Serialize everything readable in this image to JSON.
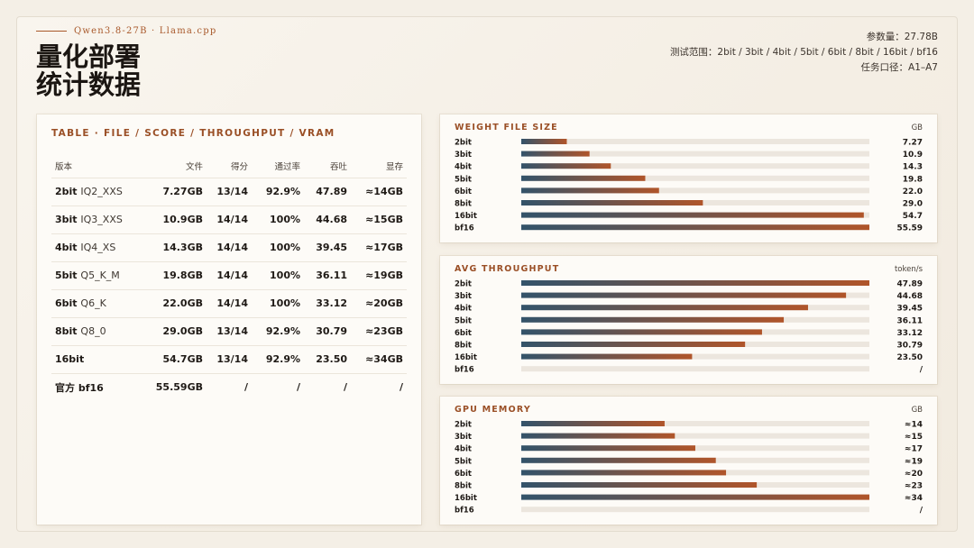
{
  "header": {
    "kicker": "Qwen3.8-27B  ·  Llama.cpp",
    "title_line1": "量化部署",
    "title_line2": "统计数据",
    "meta_params": "参数量：27.78B",
    "meta_range": "测试范围：2bit / 3bit / 4bit / 5bit / 6bit / 8bit / 16bit / bf16",
    "meta_tasks": "任务口径：A1–A7"
  },
  "table": {
    "title": "TABLE · FILE / SCORE / THROUGHPUT / VRAM",
    "headers": [
      "版本",
      "文件",
      "得分",
      "通过率",
      "吞吐",
      "显存"
    ],
    "rows": [
      {
        "bits": "2bit",
        "quant": "IQ2_XXS",
        "file": "7.27GB",
        "score": "13/14",
        "pass": "92.9%",
        "tput": "47.89",
        "vram": "≈14GB"
      },
      {
        "bits": "3bit",
        "quant": "IQ3_XXS",
        "file": "10.9GB",
        "score": "14/14",
        "pass": "100%",
        "tput": "44.68",
        "vram": "≈15GB"
      },
      {
        "bits": "4bit",
        "quant": "IQ4_XS",
        "file": "14.3GB",
        "score": "14/14",
        "pass": "100%",
        "tput": "39.45",
        "vram": "≈17GB"
      },
      {
        "bits": "5bit",
        "quant": "Q5_K_M",
        "file": "19.8GB",
        "score": "14/14",
        "pass": "100%",
        "tput": "36.11",
        "vram": "≈19GB"
      },
      {
        "bits": "6bit",
        "quant": "Q6_K",
        "file": "22.0GB",
        "score": "14/14",
        "pass": "100%",
        "tput": "33.12",
        "vram": "≈20GB"
      },
      {
        "bits": "8bit",
        "quant": "Q8_0",
        "file": "29.0GB",
        "score": "13/14",
        "pass": "92.9%",
        "tput": "30.79",
        "vram": "≈23GB"
      },
      {
        "bits": "16bit",
        "quant": "",
        "file": "54.7GB",
        "score": "13/14",
        "pass": "92.9%",
        "tput": "23.50",
        "vram": "≈34GB"
      },
      {
        "bits": "官方 bf16",
        "quant": "",
        "file": "55.59GB",
        "score": "/",
        "pass": "/",
        "tput": "/",
        "vram": "/"
      }
    ]
  },
  "colors": {
    "bar_start": "#33536a",
    "bar_end": "#b0552a",
    "track": "#ece6de",
    "accent": "#9a4f26"
  },
  "chart_data": [
    {
      "type": "bar",
      "title": "WEIGHT FILE SIZE",
      "unit": "GB",
      "categories": [
        "2bit",
        "3bit",
        "4bit",
        "5bit",
        "6bit",
        "8bit",
        "16bit",
        "bf16"
      ],
      "values": [
        7.27,
        10.9,
        14.3,
        19.8,
        22.0,
        29.0,
        54.7,
        55.59
      ],
      "labels": [
        "7.27",
        "10.9",
        "14.3",
        "19.8",
        "22.0",
        "29.0",
        "54.7",
        "55.59"
      ],
      "max": 55.59
    },
    {
      "type": "bar",
      "title": "AVG THROUGHPUT",
      "unit": "token/s",
      "categories": [
        "2bit",
        "3bit",
        "4bit",
        "5bit",
        "6bit",
        "8bit",
        "16bit",
        "bf16"
      ],
      "values": [
        47.89,
        44.68,
        39.45,
        36.11,
        33.12,
        30.79,
        23.5,
        null
      ],
      "labels": [
        "47.89",
        "44.68",
        "39.45",
        "36.11",
        "33.12",
        "30.79",
        "23.50",
        "/"
      ],
      "max": 47.89
    },
    {
      "type": "bar",
      "title": "GPU MEMORY",
      "unit": "GB",
      "categories": [
        "2bit",
        "3bit",
        "4bit",
        "5bit",
        "6bit",
        "8bit",
        "16bit",
        "bf16"
      ],
      "values": [
        14,
        15,
        17,
        19,
        20,
        23,
        34,
        null
      ],
      "labels": [
        "≈14",
        "≈15",
        "≈17",
        "≈19",
        "≈20",
        "≈23",
        "≈34",
        "/"
      ],
      "max": 34
    }
  ]
}
